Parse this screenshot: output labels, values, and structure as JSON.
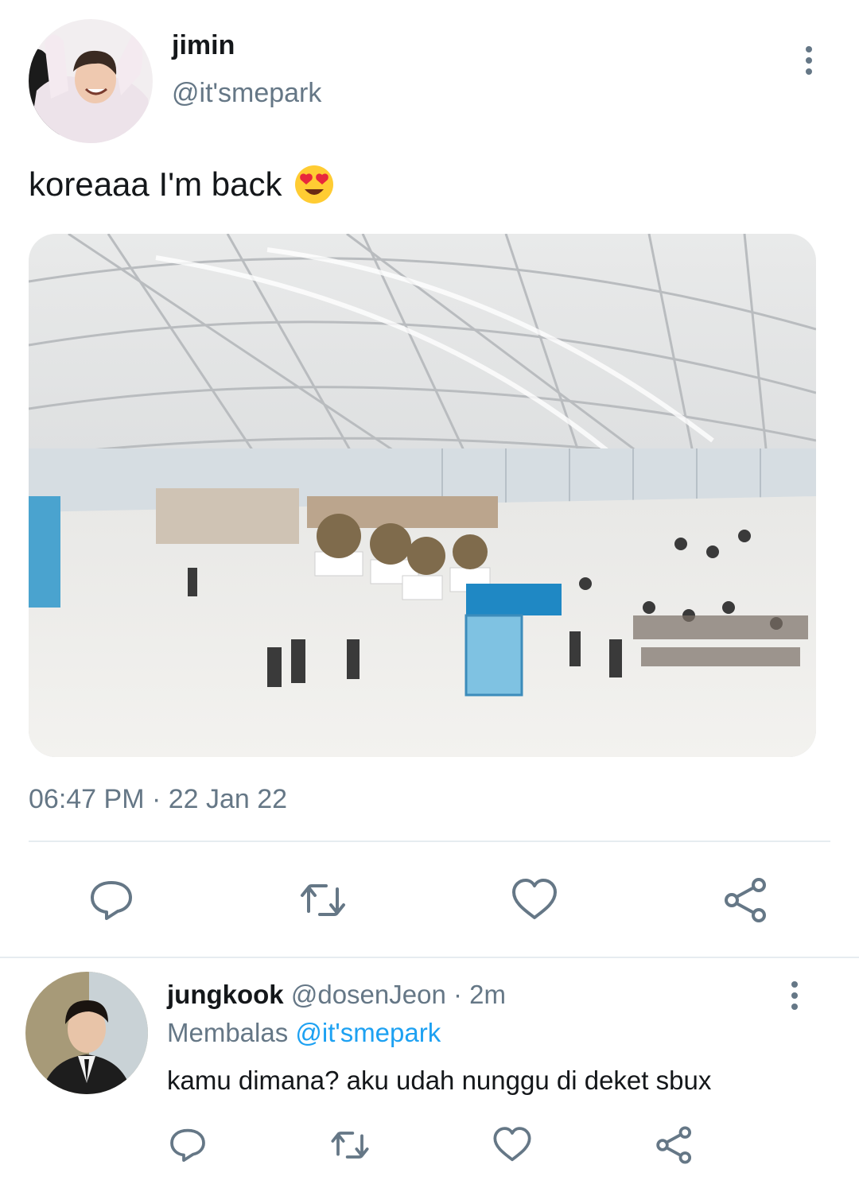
{
  "main_tweet": {
    "name": "jimin",
    "handle": "@it'smepark",
    "text": "koreaaa I'm back",
    "emoji": "heart-eyes-emoji",
    "timestamp": "06:47 PM · 22 Jan 22",
    "media": "airport-terminal-photo"
  },
  "reply_tweet": {
    "name": "jungkook",
    "handle_time": " @dosenJeon · 2m",
    "replying_label": "Membalas ",
    "replying_mention": "@it'smepark",
    "text": "kamu dimana? aku udah nunggu di deket sbux"
  },
  "actions": [
    "reply-icon",
    "retweet-icon",
    "like-icon",
    "share-icon",
    "more-icon"
  ],
  "colors": {
    "text": "#14171a",
    "secondary": "#657786",
    "accent": "#1da1f2",
    "divider": "#e6ecf0"
  }
}
